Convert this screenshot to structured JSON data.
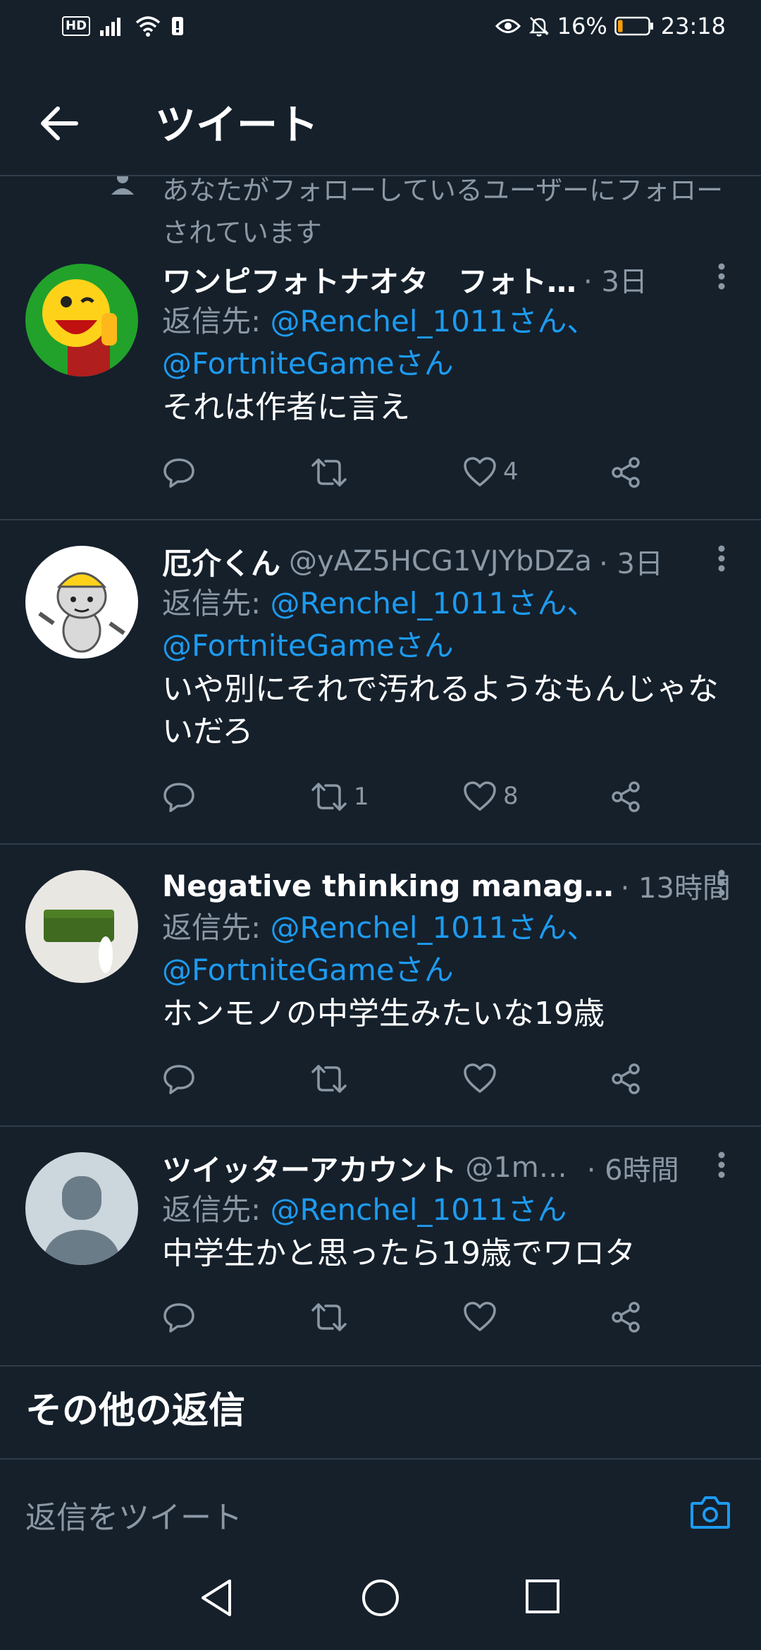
{
  "status_bar": {
    "network_badge": "HD",
    "battery_percent": "16%",
    "time": "23:18",
    "battery_level": 0.16,
    "battery_color": "#f59e0b"
  },
  "header": {
    "title": "ツイート"
  },
  "context_line": {
    "text": "あなたがフォローしているユーザーにフォローされています"
  },
  "reply_prefix": "返信先: ",
  "tweets": [
    {
      "name": "ワンピフォトナオタ　フォト…",
      "handle": "",
      "time": "· 3日",
      "reply_mentions": "@Renchel_1011さん、",
      "reply_mentions_2": "@FortniteGameさん",
      "text": "それは作者に言え",
      "retweets": "",
      "likes": "4",
      "avatar_icon": "pacman-avatar"
    },
    {
      "name": "厄介くん",
      "handle": "@yAZ5HCG1VJYbDZa",
      "time": "· 3日",
      "reply_mentions": "@Renchel_1011さん、",
      "reply_mentions_2": "@FortniteGameさん",
      "text": "いや別にそれで汚れるようなもんじゃないだろ",
      "retweets": "1",
      "likes": "8",
      "avatar_icon": "cat-avatar"
    },
    {
      "name": "Negative thinking manag…",
      "handle": "",
      "time": "· 13時間",
      "reply_mentions": "@Renchel_1011さん、",
      "reply_mentions_2": "@FortniteGameさん",
      "text": "ホンモノの中学生みたいな19歳",
      "retweets": "",
      "likes": "",
      "avatar_icon": "cake-avatar"
    },
    {
      "name": "ツイッターアカウント",
      "handle": "@1m…",
      "time": "· 6時間",
      "reply_mentions": "@Renchel_1011さん",
      "reply_mentions_2": "",
      "text": "中学生かと思ったら19歳でワロタ",
      "retweets": "",
      "likes": "",
      "avatar_icon": "default-avatar"
    }
  ],
  "more_replies_heading": "その他の返信",
  "compose": {
    "placeholder": "返信をツイート"
  },
  "colors": {
    "background": "#15202b",
    "accent": "#1d9bf0",
    "secondary_text": "#8b98a5",
    "divider": "#2f3d4b"
  }
}
